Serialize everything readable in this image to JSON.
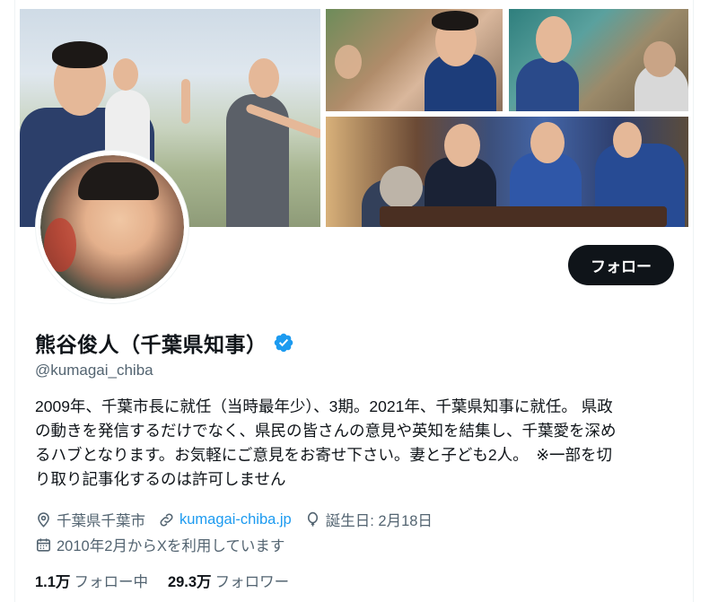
{
  "profile": {
    "display_name": "熊谷俊人（千葉県知事）",
    "handle": "@kumagai_chiba",
    "verified_icon": "verified-badge-icon",
    "follow_label": "フォロー",
    "bio": [
      "2009年、千葉市長に就任（当時最年少）、3期。2021年、千葉県知事に就任。 県政",
      "の動きを発信するだけでなく、県民の皆さんの意見や英知を結集し、千葉愛を深め",
      "るハブとなります。お気軽にご意見をお寄せ下さい。妻と子ども2人。　※一部を切",
      "り取り記事化するのは許可しません"
    ],
    "location": "千葉県千葉市",
    "website": "kumagai-chiba.jp",
    "birthday": "誕生日: 2月18日",
    "joined": "2010年2月からXを利用しています",
    "following_count": "1.1万",
    "following_label": "フォロー中",
    "followers_count": "29.3万",
    "followers_label": "フォロワー"
  },
  "colors": {
    "text_primary": "#0f1419",
    "text_secondary": "#536471",
    "link": "#1d9bf0",
    "verified": "#1d9bf0",
    "button_bg": "#0f1419"
  }
}
